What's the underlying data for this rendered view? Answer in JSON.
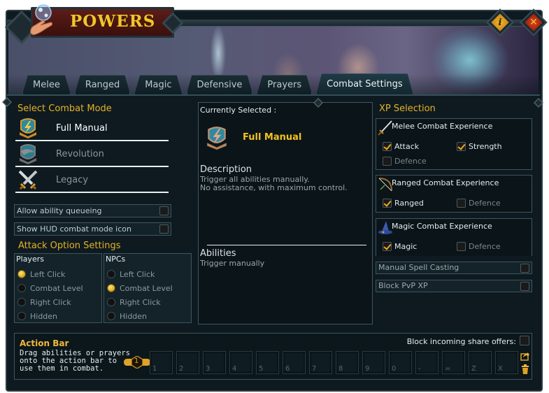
{
  "window": {
    "title": "POWERS",
    "buttons": {
      "info": "i",
      "close": "✕"
    }
  },
  "tabs": [
    {
      "label": "Melee",
      "active": false
    },
    {
      "label": "Ranged",
      "active": false
    },
    {
      "label": "Magic",
      "active": false
    },
    {
      "label": "Defensive",
      "active": false
    },
    {
      "label": "Prayers",
      "active": false
    },
    {
      "label": "Combat Settings",
      "active": true
    }
  ],
  "combat_mode": {
    "title": "Select Combat Mode",
    "modes": [
      {
        "label": "Full Manual",
        "icon": "full-manual-shield-icon",
        "selected": true
      },
      {
        "label": "Revolution",
        "icon": "revolution-shield-icon",
        "selected": false
      },
      {
        "label": "Legacy",
        "icon": "crossed-swords-icon",
        "selected": false
      }
    ],
    "toggles": [
      {
        "label": "Allow ability queueing",
        "checked": false
      },
      {
        "label": "Show HUD combat mode icon",
        "checked": false
      }
    ]
  },
  "attack_options": {
    "title": "Attack Option Settings",
    "players": {
      "header": "Players",
      "options": [
        "Left Click",
        "Combat Level",
        "Right Click",
        "Hidden"
      ],
      "selected": "Left Click"
    },
    "npcs": {
      "header": "NPCs",
      "options": [
        "Left Click",
        "Combat Level",
        "Right Click",
        "Hidden"
      ],
      "selected": "Combat Level"
    }
  },
  "current": {
    "label": "Currently Selected :",
    "mode": "Full Manual",
    "description_title": "Description",
    "description_lines": [
      "Trigger all abilities manually.",
      "No assistance, with maximum control."
    ],
    "abilities_title": "Abilities",
    "abilities_text": "Trigger manually"
  },
  "xp": {
    "title": "XP Selection",
    "groups": [
      {
        "title": "Melee Combat Experience",
        "icon": "sword-icon",
        "options": [
          {
            "label": "Attack",
            "checked": true
          },
          {
            "label": "Strength",
            "checked": true
          },
          {
            "label": "Defence",
            "checked": false
          }
        ]
      },
      {
        "title": "Ranged Combat Experience",
        "icon": "bow-icon",
        "options": [
          {
            "label": "Ranged",
            "checked": true
          },
          {
            "label": "Defence",
            "checked": false
          }
        ]
      },
      {
        "title": "Magic Combat Experience",
        "icon": "wizard-hat-icon",
        "options": [
          {
            "label": "Magic",
            "checked": true
          },
          {
            "label": "Defence",
            "checked": false
          }
        ]
      }
    ],
    "toggles": [
      {
        "label": "Manual Spell Casting",
        "checked": false
      },
      {
        "label": "Block PvP XP",
        "checked": false
      }
    ]
  },
  "action_bar": {
    "title": "Action Bar",
    "description_lines": [
      "Drag abilities or prayers",
      "onto the action bar to",
      "use them in combat."
    ],
    "bar_number": "1",
    "share_label": "Block incoming share offers:",
    "share_checked": false,
    "slots": [
      "1",
      "2",
      "3",
      "4",
      "5",
      "6",
      "7",
      "8",
      "9",
      "0",
      "-",
      "=",
      "Z",
      "X"
    ]
  },
  "colors": {
    "accent_gold": "#e5b325",
    "panel_bg": "#0e1a20",
    "border": "#3f555e",
    "title_plate": "#4a1512"
  }
}
